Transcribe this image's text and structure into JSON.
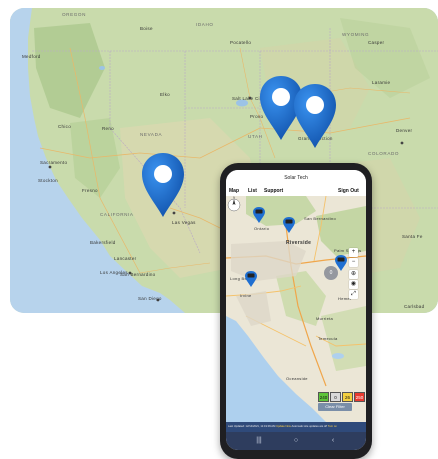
{
  "background_map": {
    "labels": {
      "oregon": "OREGON",
      "idaho": "IDAHO",
      "wyoming": "WYOMING",
      "casper": "Casper",
      "pocatello": "Pocatello",
      "medford": "Medford",
      "boise": "Boise",
      "chico": "Chico",
      "reno": "Reno",
      "elko": "Elko",
      "nevada": "NEVADA",
      "utah": "UTAH",
      "colorado": "COLORADO",
      "salt_lake_city": "Salt Lake City",
      "provo": "Provo",
      "grand_junction": "Grand Junction",
      "denver": "Denver",
      "laramie": "Laramie",
      "sacramento": "Sacramento",
      "fresno": "Fresno",
      "california": "CALIFORNIA",
      "las_vegas": "Las Vegas",
      "bakersfield": "Bakersfield",
      "lancaster": "Lancaster",
      "los_angeles": "Los Angeles",
      "san_bernardino": "San Bernardino",
      "san_diego": "San Diego",
      "santa_fe": "Santa Fe",
      "carlsbad": "Carlsbad",
      "stockton": "Stockton"
    },
    "pin_color": "#1f6fd1"
  },
  "phone": {
    "app_title": "Solar Tech",
    "nav": {
      "map": "Map",
      "list": "List",
      "support": "Support",
      "sign_out": "Sign Out"
    },
    "map_labels": {
      "ontario": "Ontario",
      "riverside": "Riverside",
      "san_bernardino": "San Bernardino",
      "irvine": "Irvine",
      "murrieta": "Murrieta",
      "oceanside": "Oceanside",
      "temecula": "Temecula",
      "hemet": "Hemet",
      "palm_springs": "Palm Springs",
      "long_beach": "Long Beach"
    },
    "ghost_button": "0",
    "counters": [
      {
        "value": "240",
        "color": "#5ec43a"
      },
      {
        "value": "0",
        "color": "#d9d9d9"
      },
      {
        "value": "26",
        "color": "#f4d03f"
      },
      {
        "value": "250",
        "color": "#e83a2f"
      }
    ],
    "clear_filter": "Clear Filter",
    "status_text_prefix": "Last Updated: 12/14/2021, 11:19:09 AM",
    "status_update_now": "Update Now",
    "status_auto": "Automatic site updates are off",
    "status_turn_on": "Turn on",
    "accent_color": "#2f4a7a"
  }
}
